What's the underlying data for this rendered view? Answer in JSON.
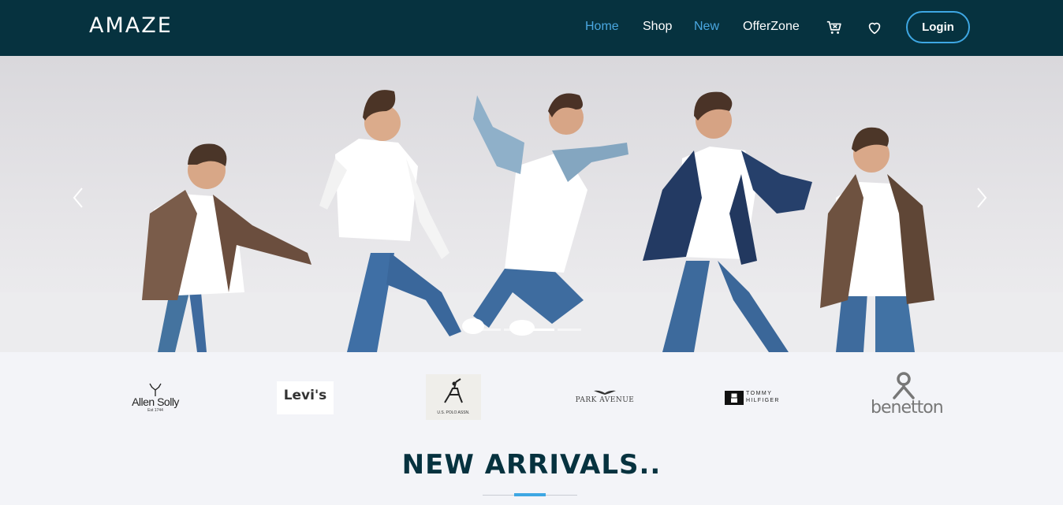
{
  "nav": {
    "brand": "AMAZE",
    "links": [
      {
        "label": "Home",
        "active": true
      },
      {
        "label": "Shop",
        "active": false
      },
      {
        "label": "New",
        "active": true
      },
      {
        "label": "OfferZone",
        "active": false
      }
    ],
    "icons": [
      "cart-icon",
      "heart-icon"
    ],
    "login_label": "Login"
  },
  "hero": {
    "slides": 4,
    "active_slide": 3,
    "prev_icon": "chevron-left-icon",
    "next_icon": "chevron-right-icon"
  },
  "brands": [
    {
      "name": "Allen Solly",
      "tagline": "Est 1744"
    },
    {
      "name": "Levi's"
    },
    {
      "name": "U.S. POLO ASSN."
    },
    {
      "name": "PARK AVENUE"
    },
    {
      "name": "TOMMY HILFIGER",
      "line1": "TOMMY",
      "line2": "HILFIGER"
    },
    {
      "name": "benetton"
    }
  ],
  "section": {
    "title": "NEW ARRIVALS.."
  },
  "colors": {
    "navbar": "#06323f",
    "accent": "#3ea7e3",
    "page_bg": "#f3f4f8"
  }
}
